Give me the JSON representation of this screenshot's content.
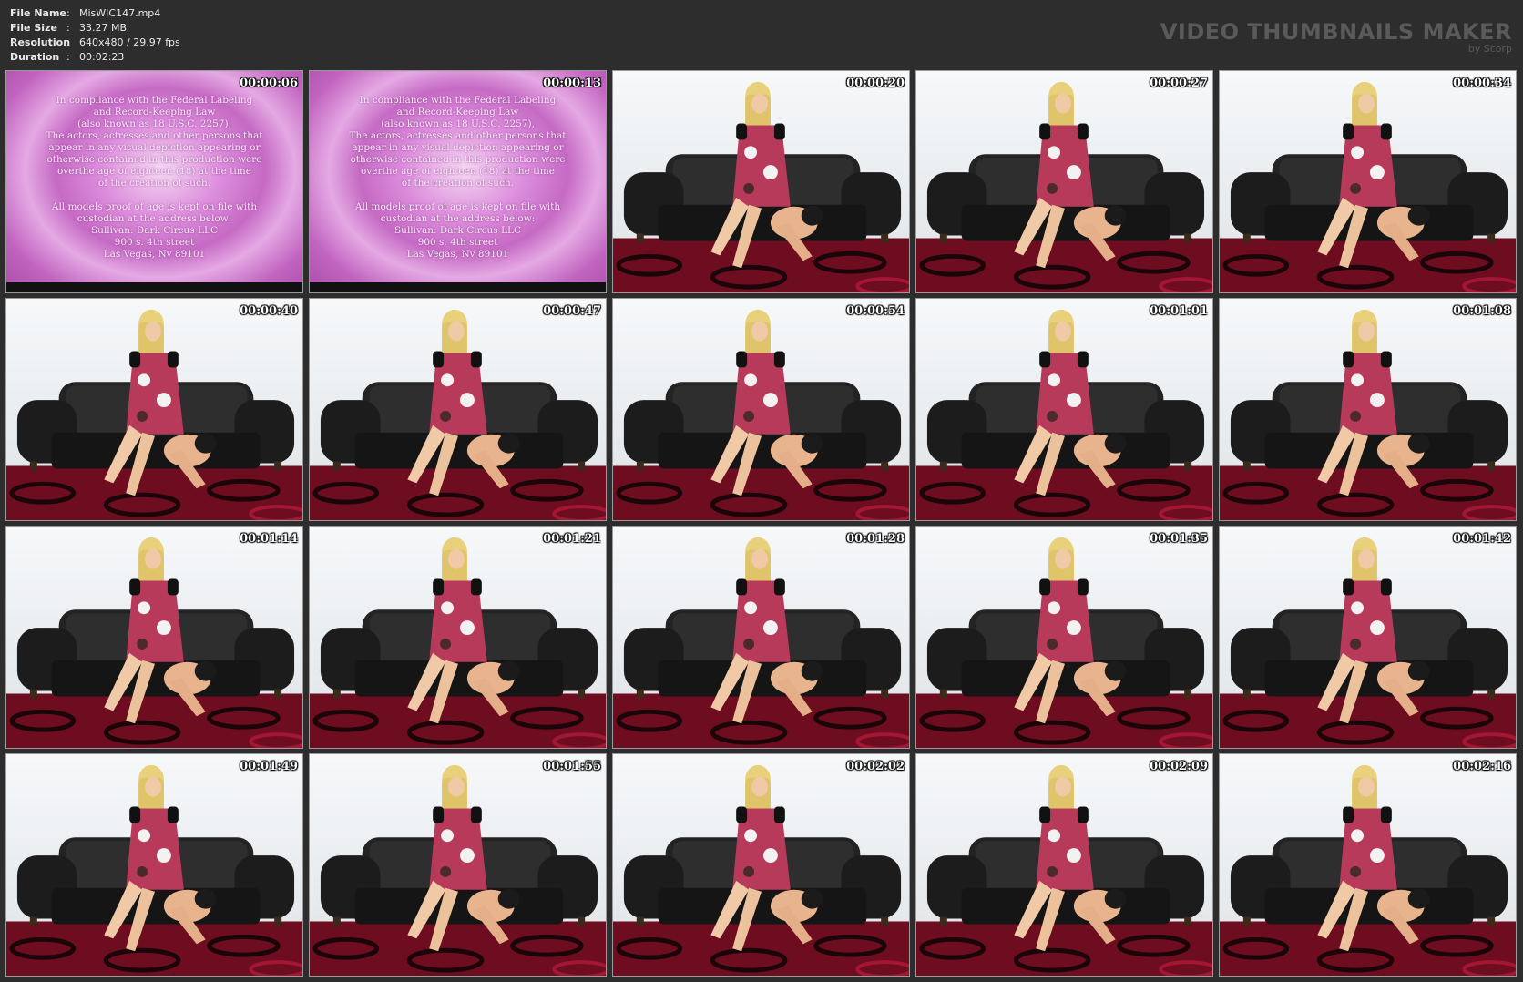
{
  "file_info": {
    "rows": [
      {
        "key": "File Name",
        "sep": ":",
        "value": "MisWIC147.mp4"
      },
      {
        "key": "File Size",
        "sep": ":",
        "value": "33.27 MB"
      },
      {
        "key": "Resolution",
        "sep": ":",
        "value": "640x480 / 29.97 fps"
      },
      {
        "key": "Duration",
        "sep": ":",
        "value": "00:02:23"
      }
    ]
  },
  "brand": {
    "title": "VIDEO THUMBNAILS MAKER",
    "subtitle": "by Scorp"
  },
  "notice": {
    "lines1": [
      "In compliance with the Federal Labeling",
      "and Record-Keeping Law",
      "(also known as 18 U.S.C. 2257),",
      "The actors, actresses and other persons that",
      "appear in any visual depiction appearing or",
      "otherwise contained in this production were",
      "overthe age of eighteen (18) at the time",
      "of the creation of such."
    ],
    "lines2": [
      "All models proof of age is kept on file with",
      "custodian at the address below:",
      "Sullivan: Dark Circus LLC",
      "900 s. 4th street",
      "Las Vegas, Nv 89101"
    ]
  },
  "thumbnails": [
    {
      "time": "00:00:06",
      "kind": "notice"
    },
    {
      "time": "00:00:13",
      "kind": "notice"
    },
    {
      "time": "00:00:20",
      "kind": "scene"
    },
    {
      "time": "00:00:27",
      "kind": "scene"
    },
    {
      "time": "00:00:34",
      "kind": "scene"
    },
    {
      "time": "00:00:40",
      "kind": "scene"
    },
    {
      "time": "00:00:47",
      "kind": "scene"
    },
    {
      "time": "00:00:54",
      "kind": "scene"
    },
    {
      "time": "00:01:01",
      "kind": "scene"
    },
    {
      "time": "00:01:08",
      "kind": "scene"
    },
    {
      "time": "00:01:14",
      "kind": "scene"
    },
    {
      "time": "00:01:21",
      "kind": "scene"
    },
    {
      "time": "00:01:28",
      "kind": "scene"
    },
    {
      "time": "00:01:35",
      "kind": "scene"
    },
    {
      "time": "00:01:42",
      "kind": "scene"
    },
    {
      "time": "00:01:49",
      "kind": "scene"
    },
    {
      "time": "00:01:55",
      "kind": "scene"
    },
    {
      "time": "00:02:02",
      "kind": "scene"
    },
    {
      "time": "00:02:09",
      "kind": "scene"
    },
    {
      "time": "00:02:16",
      "kind": "scene"
    }
  ],
  "colors": {
    "background": "#2d2d2d",
    "sofa": "#1c1c1c",
    "carpet": "#7a0f24",
    "dress": "#b83a5a"
  }
}
